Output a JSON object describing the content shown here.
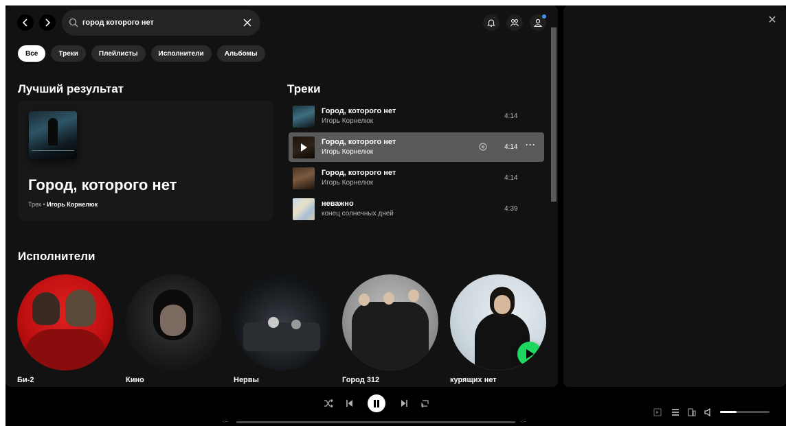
{
  "search": {
    "query": "город которого нет"
  },
  "filters": [
    {
      "label": "Все",
      "active": true
    },
    {
      "label": "Треки",
      "active": false
    },
    {
      "label": "Плейлисты",
      "active": false
    },
    {
      "label": "Исполнители",
      "active": false
    },
    {
      "label": "Альбомы",
      "active": false
    }
  ],
  "best_result": {
    "section_title": "Лучший результат",
    "title": "Город, которого нет",
    "type": "Трек",
    "separator": "•",
    "artist": "Игорь Корнелюк"
  },
  "tracks": {
    "section_title": "Треки",
    "items": [
      {
        "title": "Город, которого нет",
        "artist": "Игорь Корнелюк",
        "duration": "4:14"
      },
      {
        "title": "Город, которого нет",
        "artist": "Игорь Корнелюк",
        "duration": "4:14",
        "hovered": true
      },
      {
        "title": "Город, которого нет",
        "artist": "Игорь Корнелюк",
        "duration": "4:14"
      },
      {
        "title": "неважно",
        "artist": "конец солнечных дней",
        "duration": "4:39"
      }
    ]
  },
  "artists": {
    "section_title": "Исполнители",
    "items": [
      {
        "name": "Би-2"
      },
      {
        "name": "Кино"
      },
      {
        "name": "Нервы"
      },
      {
        "name": "Город 312"
      },
      {
        "name": "курящих нет"
      }
    ]
  },
  "player": {
    "time_elapsed": "-:--",
    "time_total": "-:--",
    "volume_fraction": 0.33
  },
  "colors": {
    "accent_green": "#1ed760",
    "notification_dot": "#3d91f4",
    "surface": "#121212"
  }
}
